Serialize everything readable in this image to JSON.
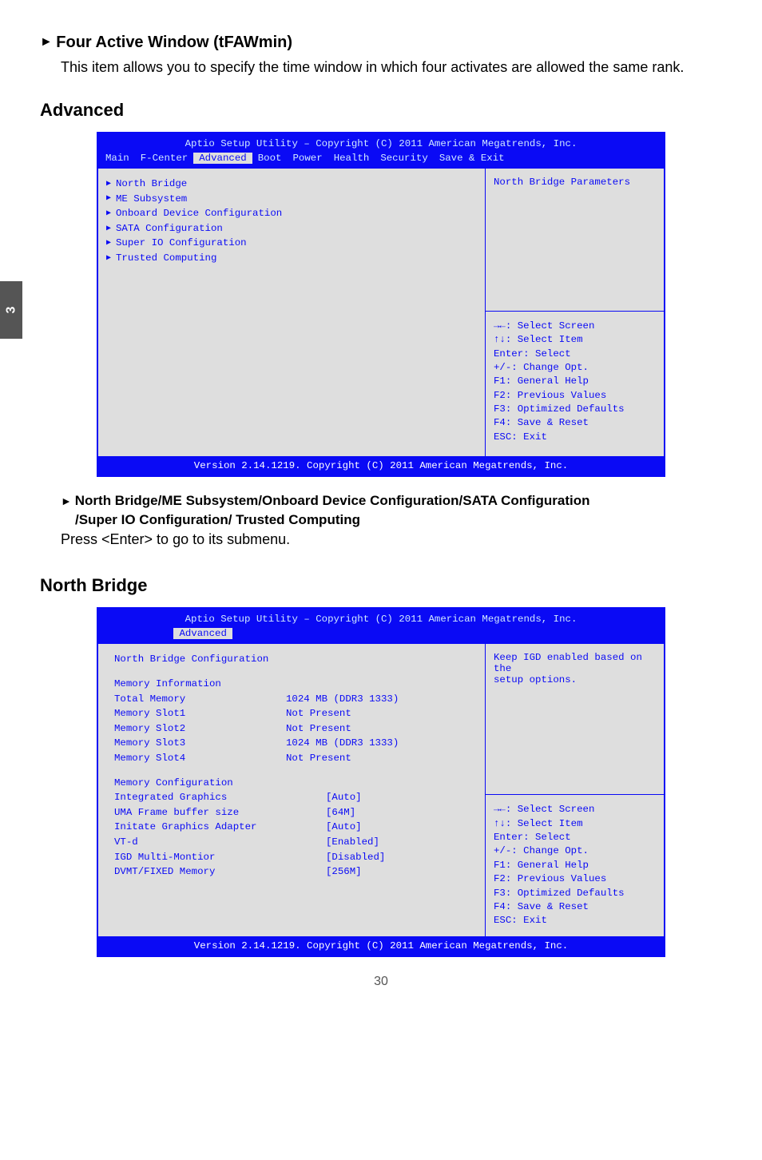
{
  "side_tab": "3",
  "sec1": {
    "title": "Four Active Window (tFAWmin)",
    "body": "This item allows you to specify the time window in which four activates are allowed the same rank."
  },
  "sec2": {
    "title": "Advanced",
    "sub_line1": "North Bridge/ME Subsystem/Onboard Device Configuration/SATA Configuration",
    "sub_line2": "/Super IO Configuration/ Trusted Computing",
    "body": "Press <Enter> to go to its submenu."
  },
  "sec3": {
    "title": "North Bridge"
  },
  "bios_common": {
    "title": "Aptio Setup Utility – Copyright (C) 2011 American Megatrends, Inc.",
    "footer": "Version 2.14.1219. Copyright (C) 2011 American Megatrends, Inc.",
    "keys": {
      "k1": "→←: Select Screen",
      "k2": "↑↓: Select Item",
      "k3": "Enter: Select",
      "k4": "+/-: Change Opt.",
      "k5": "F1: General Help",
      "k6": "F2: Previous Values",
      "k7": "F3: Optimized Defaults",
      "k8": "F4: Save & Reset",
      "k9": "ESC: Exit"
    }
  },
  "bios1": {
    "tabs": [
      "Main",
      "F-Center",
      "Advanced",
      "Boot",
      "Power",
      "Health",
      "Security",
      "Save & Exit"
    ],
    "active_tab": "Advanced",
    "items": [
      "North Bridge",
      "ME Subsystem",
      "Onboard Device Configuration",
      "SATA Configuration",
      "Super IO Configuration",
      "Trusted Computing"
    ],
    "help": "North Bridge Parameters"
  },
  "bios2": {
    "tabs_single": "Advanced",
    "heading": "North Bridge Configuration",
    "help_l1": "Keep IGD enabled based on the",
    "help_l2": "setup options.",
    "info_heading": "Memory Information",
    "info": [
      {
        "label": "Total Memory",
        "value": "1024 MB (DDR3 1333)"
      },
      {
        "label": "Memory Slot1",
        "value": "Not Present"
      },
      {
        "label": "Memory Slot2",
        "value": "Not Present"
      },
      {
        "label": "Memory Slot3",
        "value": "1024 MB (DDR3 1333)"
      },
      {
        "label": "Memory Slot4",
        "value": "Not Present"
      }
    ],
    "cfg_heading": "Memory Configuration",
    "cfg": [
      {
        "label": "Integrated Graphics",
        "value": "[Auto]"
      },
      {
        "label": "UMA Frame buffer size",
        "value": "[64M]"
      },
      {
        "label": "Initate Graphics Adapter",
        "value": "[Auto]"
      },
      {
        "label": "VT-d",
        "value": "[Enabled]"
      },
      {
        "label": "IGD Multi-Montior",
        "value": "[Disabled]"
      },
      {
        "label": "DVMT/FIXED Memory",
        "value": "[256M]"
      }
    ]
  },
  "page": "30"
}
